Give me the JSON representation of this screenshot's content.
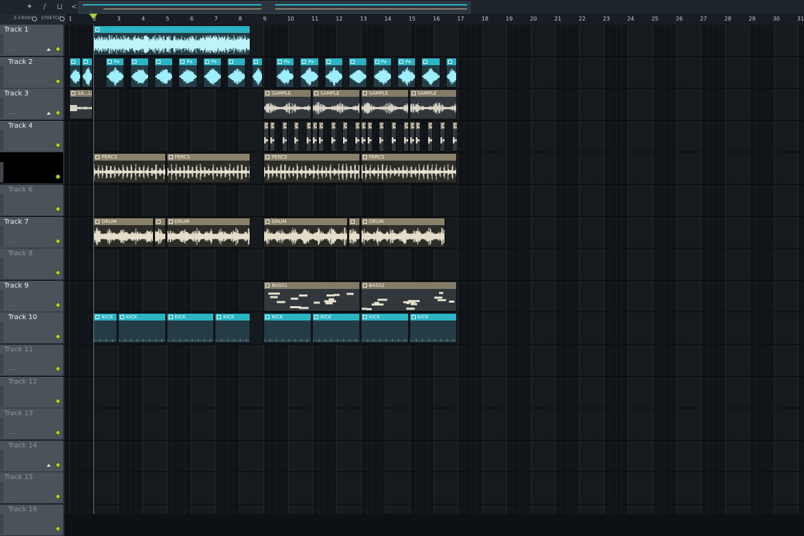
{
  "toolbar": {
    "icons": [
      "wave-icon",
      "slice-icon",
      "paint-icon"
    ],
    "options": [
      {
        "label": "Z-CROSS",
        "checked": false
      },
      {
        "label": "STRETCH",
        "checked": false
      }
    ],
    "nav_back": "<"
  },
  "ruler": {
    "bars": [
      "1",
      "2",
      "3",
      "4",
      "5",
      "6",
      "7",
      "8",
      "9",
      "10",
      "11",
      "12",
      "13",
      "14",
      "15",
      "16",
      "17",
      "18",
      "19",
      "20",
      "21",
      "22",
      "23",
      "24",
      "25",
      "26",
      "27",
      "28",
      "29",
      "30",
      "31"
    ],
    "playhead_bar": 2
  },
  "tracks": [
    {
      "name": "Track 1",
      "muted": false,
      "selected": false
    },
    {
      "name": "Track 2",
      "muted": false,
      "selected": false
    },
    {
      "name": "Track 3",
      "muted": false,
      "selected": false
    },
    {
      "name": "Track 4",
      "muted": false,
      "selected": false
    },
    {
      "name": "",
      "muted": false,
      "selected": true
    },
    {
      "name": "Track 6",
      "muted": true,
      "selected": false
    },
    {
      "name": "Track 7",
      "muted": false,
      "selected": false
    },
    {
      "name": "Track 8",
      "muted": true,
      "selected": false
    },
    {
      "name": "Track 9",
      "muted": false,
      "selected": false
    },
    {
      "name": "Track 10",
      "muted": false,
      "selected": false
    },
    {
      "name": "Track 11",
      "muted": true,
      "selected": false
    },
    {
      "name": "Track 12",
      "muted": true,
      "selected": false
    },
    {
      "name": "Track 13",
      "muted": true,
      "selected": false
    },
    {
      "name": "Track 14",
      "muted": true,
      "selected": false
    },
    {
      "name": "Track 15",
      "muted": true,
      "selected": false
    },
    {
      "name": "Track 16",
      "muted": true,
      "selected": false
    }
  ],
  "clips": [
    {
      "track": 0,
      "start": 2,
      "end": 8.5,
      "label": "",
      "style": "cyan",
      "kind": "dense"
    },
    {
      "track": 1,
      "start": 1,
      "end": 1.5,
      "label": "",
      "style": "cyan",
      "kind": "hit"
    },
    {
      "track": 1,
      "start": 1.5,
      "end": 2,
      "label": "",
      "style": "cyan",
      "kind": "hit"
    },
    {
      "track": 1,
      "start": 2.5,
      "end": 3.3,
      "label": "Pa",
      "style": "cyan",
      "kind": "hit"
    },
    {
      "track": 1,
      "start": 3.5,
      "end": 4.3,
      "label": "",
      "style": "cyan",
      "kind": "hit"
    },
    {
      "track": 1,
      "start": 4.5,
      "end": 5.3,
      "label": "",
      "style": "cyan",
      "kind": "hit"
    },
    {
      "track": 1,
      "start": 5.5,
      "end": 6.3,
      "label": "Pa",
      "style": "cyan",
      "kind": "hit"
    },
    {
      "track": 1,
      "start": 6.5,
      "end": 7.3,
      "label": "Pa",
      "style": "cyan",
      "kind": "hit"
    },
    {
      "track": 1,
      "start": 7.5,
      "end": 8.3,
      "label": "",
      "style": "cyan",
      "kind": "hit"
    },
    {
      "track": 1,
      "start": 8.5,
      "end": 9,
      "label": "",
      "style": "cyan",
      "kind": "hit"
    },
    {
      "track": 1,
      "start": 9.5,
      "end": 10.3,
      "label": "Pa",
      "style": "cyan",
      "kind": "hit"
    },
    {
      "track": 1,
      "start": 10.5,
      "end": 11.3,
      "label": "Pa",
      "style": "cyan",
      "kind": "hit"
    },
    {
      "track": 1,
      "start": 11.5,
      "end": 12.3,
      "label": "",
      "style": "cyan",
      "kind": "hit"
    },
    {
      "track": 1,
      "start": 12.5,
      "end": 13.3,
      "label": "",
      "style": "cyan",
      "kind": "hit"
    },
    {
      "track": 1,
      "start": 13.5,
      "end": 14.3,
      "label": "Pa",
      "style": "cyan",
      "kind": "hit"
    },
    {
      "track": 1,
      "start": 14.5,
      "end": 15.3,
      "label": "Pa",
      "style": "cyan",
      "kind": "hit"
    },
    {
      "track": 1,
      "start": 15.5,
      "end": 16.3,
      "label": "",
      "style": "cyan",
      "kind": "hit"
    },
    {
      "track": 1,
      "start": 16.5,
      "end": 17,
      "label": "",
      "style": "cyan",
      "kind": "hit"
    },
    {
      "track": 2,
      "start": 1,
      "end": 2,
      "label": "SA...LE",
      "style": "gray",
      "kind": "tail"
    },
    {
      "track": 2,
      "start": 9,
      "end": 11,
      "label": "SAMPLE",
      "style": "gray",
      "kind": "chop"
    },
    {
      "track": 2,
      "start": 11,
      "end": 13,
      "label": "SAMPLE",
      "style": "gray",
      "kind": "chop"
    },
    {
      "track": 2,
      "start": 13,
      "end": 15,
      "label": "SAMPLE",
      "style": "gray",
      "kind": "chop"
    },
    {
      "track": 2,
      "start": 15,
      "end": 17,
      "label": "SAMPLE",
      "style": "gray",
      "kind": "chop"
    },
    {
      "track": 3,
      "start": 9,
      "end": 9.25,
      "label": "",
      "style": "gray",
      "kind": "tail"
    },
    {
      "track": 3,
      "start": 9.25,
      "end": 9.5,
      "label": "",
      "style": "gray",
      "kind": "tail"
    },
    {
      "track": 3,
      "start": 9.75,
      "end": 10,
      "label": "",
      "style": "gray",
      "kind": "tail"
    },
    {
      "track": 3,
      "start": 10.25,
      "end": 10.5,
      "label": "",
      "style": "gray",
      "kind": "tail"
    },
    {
      "track": 3,
      "start": 10.75,
      "end": 11,
      "label": "",
      "style": "gray",
      "kind": "tail"
    },
    {
      "track": 3,
      "start": 11,
      "end": 11.25,
      "label": "",
      "style": "gray",
      "kind": "tail"
    },
    {
      "track": 3,
      "start": 11.25,
      "end": 11.5,
      "label": "",
      "style": "gray",
      "kind": "tail"
    },
    {
      "track": 3,
      "start": 11.75,
      "end": 12,
      "label": "",
      "style": "gray",
      "kind": "tail"
    },
    {
      "track": 3,
      "start": 12.25,
      "end": 12.5,
      "label": "",
      "style": "gray",
      "kind": "tail"
    },
    {
      "track": 3,
      "start": 12.75,
      "end": 13,
      "label": "",
      "style": "gray",
      "kind": "tail"
    },
    {
      "track": 3,
      "start": 13,
      "end": 13.25,
      "label": "",
      "style": "gray",
      "kind": "tail"
    },
    {
      "track": 3,
      "start": 13.25,
      "end": 13.5,
      "label": "",
      "style": "gray",
      "kind": "tail"
    },
    {
      "track": 3,
      "start": 13.75,
      "end": 14,
      "label": "",
      "style": "gray",
      "kind": "tail"
    },
    {
      "track": 3,
      "start": 14.25,
      "end": 14.5,
      "label": "",
      "style": "gray",
      "kind": "tail"
    },
    {
      "track": 3,
      "start": 14.75,
      "end": 15,
      "label": "",
      "style": "gray",
      "kind": "tail"
    },
    {
      "track": 3,
      "start": 15,
      "end": 15.25,
      "label": "",
      "style": "gray",
      "kind": "tail"
    },
    {
      "track": 3,
      "start": 15.25,
      "end": 15.5,
      "label": "",
      "style": "gray",
      "kind": "tail"
    },
    {
      "track": 3,
      "start": 15.75,
      "end": 16,
      "label": "",
      "style": "gray",
      "kind": "tail"
    },
    {
      "track": 3,
      "start": 16.25,
      "end": 16.5,
      "label": "",
      "style": "gray",
      "kind": "tail"
    },
    {
      "track": 3,
      "start": 16.75,
      "end": 17,
      "label": "",
      "style": "gray",
      "kind": "tail"
    },
    {
      "track": 4,
      "start": 2,
      "end": 5,
      "label": "PERCS",
      "style": "tan",
      "kind": "perc"
    },
    {
      "track": 4,
      "start": 5,
      "end": 8.5,
      "label": "PERCS",
      "style": "tan",
      "kind": "perc"
    },
    {
      "track": 4,
      "start": 9,
      "end": 13,
      "label": "PERCS",
      "style": "tan",
      "kind": "perc"
    },
    {
      "track": 4,
      "start": 13,
      "end": 17,
      "label": "PERCS",
      "style": "tan",
      "kind": "perc"
    },
    {
      "track": 6,
      "start": 2,
      "end": 4.5,
      "label": "DRUM",
      "style": "tan",
      "kind": "drum"
    },
    {
      "track": 6,
      "start": 4.5,
      "end": 5,
      "label": "",
      "style": "tan",
      "kind": "drum"
    },
    {
      "track": 6,
      "start": 5,
      "end": 8.5,
      "label": "DRUM",
      "style": "tan",
      "kind": "drum"
    },
    {
      "track": 6,
      "start": 9,
      "end": 12.5,
      "label": "DRUM",
      "style": "tan",
      "kind": "drum"
    },
    {
      "track": 6,
      "start": 12.5,
      "end": 13,
      "label": "",
      "style": "tan",
      "kind": "drum"
    },
    {
      "track": 6,
      "start": 13,
      "end": 16.5,
      "label": "DRUM",
      "style": "tan",
      "kind": "drum"
    },
    {
      "track": 8,
      "start": 9,
      "end": 13,
      "label": "BASS1",
      "style": "gray",
      "kind": "notes"
    },
    {
      "track": 8,
      "start": 13,
      "end": 17,
      "label": "BASS2",
      "style": "gray",
      "kind": "notes"
    },
    {
      "track": 9,
      "start": 2,
      "end": 3,
      "label": "KICK",
      "style": "cyan",
      "kind": "kick"
    },
    {
      "track": 9,
      "start": 3,
      "end": 5,
      "label": "KICK",
      "style": "cyan",
      "kind": "kick"
    },
    {
      "track": 9,
      "start": 5,
      "end": 7,
      "label": "KICK",
      "style": "cyan",
      "kind": "kick"
    },
    {
      "track": 9,
      "start": 7,
      "end": 8.5,
      "label": "KICK",
      "style": "cyan",
      "kind": "kick"
    },
    {
      "track": 9,
      "start": 9,
      "end": 11,
      "label": "KICK",
      "style": "cyan",
      "kind": "kick"
    },
    {
      "track": 9,
      "start": 11,
      "end": 13,
      "label": "KICK",
      "style": "cyan",
      "kind": "kick"
    },
    {
      "track": 9,
      "start": 13,
      "end": 15,
      "label": "KICK",
      "style": "cyan",
      "kind": "kick"
    },
    {
      "track": 9,
      "start": 15,
      "end": 17,
      "label": "KICK",
      "style": "cyan",
      "kind": "kick"
    }
  ],
  "colors": {
    "cyan": "#2ab4c4",
    "tan": "#8a8069",
    "led": "#a8d43c",
    "track_header": "#4a5359",
    "background": "#101419"
  }
}
